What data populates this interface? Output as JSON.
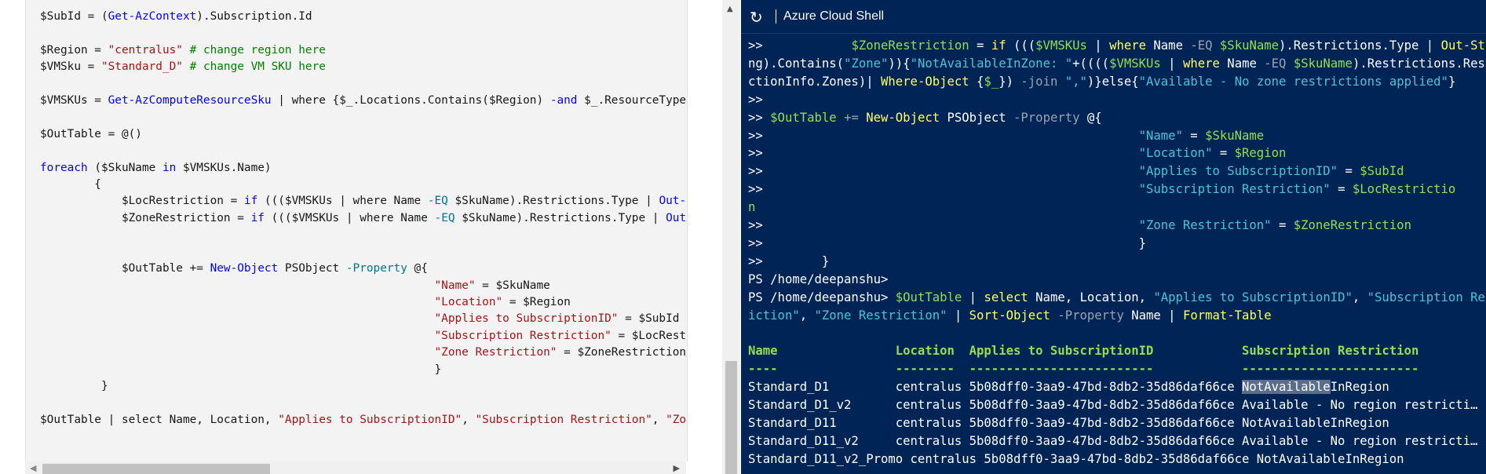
{
  "editor": {
    "lines": [
      [
        {
          "t": "$SubId = ("
        },
        {
          "t": "Get-AzContext",
          "c": "k"
        },
        {
          "t": ").Subscription.Id"
        }
      ],
      [],
      [
        {
          "t": "$Region = "
        },
        {
          "t": "\"centralus\"",
          "c": "s"
        },
        {
          "t": " # change region here",
          "c": "c"
        }
      ],
      [
        {
          "t": "$VMSku = "
        },
        {
          "t": "\"Standard_D\"",
          "c": "s"
        },
        {
          "t": " # change VM SKU here",
          "c": "c"
        }
      ],
      [],
      [
        {
          "t": "$VMSKUs = "
        },
        {
          "t": "Get-AzComputeResourceSku",
          "c": "k"
        },
        {
          "t": " | where {$_.Locations.Contains($Region) "
        },
        {
          "t": "-and",
          "c": "o"
        },
        {
          "t": " $_.ResourceType"
        }
      ],
      [],
      [
        {
          "t": "$OutTable = @()"
        }
      ],
      [],
      [
        {
          "t": "foreach",
          "c": "k"
        },
        {
          "t": " ($SkuName "
        },
        {
          "t": "in",
          "c": "k"
        },
        {
          "t": " $VMSKUs.Name)"
        }
      ],
      [
        {
          "t": "        {"
        }
      ],
      [
        {
          "t": "            $LocRestriction = "
        },
        {
          "t": "if",
          "c": "k"
        },
        {
          "t": " ((($VMSKUs | where Name "
        },
        {
          "t": "-EQ",
          "c": "p"
        },
        {
          "t": " $SkuName).Restrictions.Type | "
        },
        {
          "t": "Out-",
          "c": "k"
        }
      ],
      [
        {
          "t": "            $ZoneRestriction = "
        },
        {
          "t": "if",
          "c": "k"
        },
        {
          "t": " ((($VMSKUs | where Name "
        },
        {
          "t": "-EQ",
          "c": "p"
        },
        {
          "t": " $SkuName).Restrictions.Type | "
        },
        {
          "t": "Out",
          "c": "k"
        }
      ],
      [],
      [],
      [
        {
          "t": "            $OutTable += "
        },
        {
          "t": "New-Object",
          "c": "k"
        },
        {
          "t": " PSObject "
        },
        {
          "t": "-Property",
          "c": "p"
        },
        {
          "t": " @{"
        }
      ],
      [
        {
          "t": "                                                          "
        },
        {
          "t": "\"Name\"",
          "c": "s"
        },
        {
          "t": " = $SkuName"
        }
      ],
      [
        {
          "t": "                                                          "
        },
        {
          "t": "\"Location\"",
          "c": "s"
        },
        {
          "t": " = $Region"
        }
      ],
      [
        {
          "t": "                                                          "
        },
        {
          "t": "\"Applies to SubscriptionID\"",
          "c": "s"
        },
        {
          "t": " = $SubId"
        }
      ],
      [
        {
          "t": "                                                          "
        },
        {
          "t": "\"Subscription Restriction\"",
          "c": "s"
        },
        {
          "t": " = $LocRestr"
        }
      ],
      [
        {
          "t": "                                                          "
        },
        {
          "t": "\"Zone Restriction\"",
          "c": "s"
        },
        {
          "t": " = $ZoneRestriction"
        }
      ],
      [
        {
          "t": "                                                          }"
        }
      ],
      [
        {
          "t": "         }"
        }
      ],
      [],
      [
        {
          "t": "$OutTable | select Name, Location, "
        },
        {
          "t": "\"Applies to SubscriptionID\"",
          "c": "s"
        },
        {
          "t": ", "
        },
        {
          "t": "\"Subscription Restriction\"",
          "c": "s"
        },
        {
          "t": ", "
        },
        {
          "t": "\"Zo",
          "c": "s"
        }
      ]
    ]
  },
  "shell": {
    "title": "Azure Cloud Shell",
    "refresh_icon": "refresh-icon",
    "lines": [
      [
        {
          "t": ">>            "
        },
        {
          "t": "$ZoneRestriction",
          "c": "v"
        },
        {
          "t": " = "
        },
        {
          "t": "if",
          "c": "f"
        },
        {
          "t": " ((("
        },
        {
          "t": "$VMSKUs",
          "c": "v"
        },
        {
          "t": " | "
        },
        {
          "t": "where",
          "c": "f"
        },
        {
          "t": " Name "
        },
        {
          "t": "-EQ",
          "c": "o"
        },
        {
          "t": " "
        },
        {
          "t": "$SkuName",
          "c": "v"
        },
        {
          "t": ").Restrictions.Type | "
        },
        {
          "t": "Out-Stri",
          "c": "f"
        }
      ],
      [
        {
          "t": "ng).Contains("
        },
        {
          "t": "\"Zone\"",
          "c": "s"
        },
        {
          "t": ")){"
        },
        {
          "t": "\"NotAvailableInZone: \"",
          "c": "s"
        },
        {
          "t": "+(((("
        },
        {
          "t": "$VMSKUs",
          "c": "v"
        },
        {
          "t": " | "
        },
        {
          "t": "where",
          "c": "f"
        },
        {
          "t": " Name "
        },
        {
          "t": "-EQ",
          "c": "o"
        },
        {
          "t": " "
        },
        {
          "t": "$SkuName",
          "c": "v"
        },
        {
          "t": ").Restrictions.Restri"
        }
      ],
      [
        {
          "t": "ctionInfo.Zones)| "
        },
        {
          "t": "Where-Object",
          "c": "f"
        },
        {
          "t": " {"
        },
        {
          "t": "$_",
          "c": "v"
        },
        {
          "t": "}) "
        },
        {
          "t": "-join",
          "c": "o"
        },
        {
          "t": " "
        },
        {
          "t": "\",\"",
          "c": "s"
        },
        {
          "t": ")}else{"
        },
        {
          "t": "\"Available - No zone restrictions applied\"",
          "c": "s"
        },
        {
          "t": "}"
        }
      ],
      [
        {
          "t": ">>"
        }
      ],
      [
        {
          "t": ">> "
        },
        {
          "t": "$OutTable",
          "c": "v"
        },
        {
          "t": " "
        },
        {
          "t": "+=",
          "c": "o"
        },
        {
          "t": " "
        },
        {
          "t": "New-Object",
          "c": "f"
        },
        {
          "t": " PSObject "
        },
        {
          "t": "-Property",
          "c": "o"
        },
        {
          "t": " @{"
        }
      ],
      [
        {
          "t": ">>                                                   "
        },
        {
          "t": "\"Name\"",
          "c": "s"
        },
        {
          "t": " = "
        },
        {
          "t": "$SkuName",
          "c": "v"
        }
      ],
      [
        {
          "t": ">>                                                   "
        },
        {
          "t": "\"Location\"",
          "c": "s"
        },
        {
          "t": " = "
        },
        {
          "t": "$Region",
          "c": "v"
        }
      ],
      [
        {
          "t": ">>                                                   "
        },
        {
          "t": "\"Applies to SubscriptionID\"",
          "c": "s"
        },
        {
          "t": " = "
        },
        {
          "t": "$SubId",
          "c": "v"
        }
      ],
      [
        {
          "t": ">>                                                   "
        },
        {
          "t": "\"Subscription Restriction\"",
          "c": "s"
        },
        {
          "t": " = "
        },
        {
          "t": "$LocRestrictio",
          "c": "v"
        }
      ],
      [
        {
          "t": "n",
          "c": "v"
        }
      ],
      [
        {
          "t": ">>                                                   "
        },
        {
          "t": "\"Zone Restriction\"",
          "c": "s"
        },
        {
          "t": " = "
        },
        {
          "t": "$ZoneRestriction",
          "c": "v"
        }
      ],
      [
        {
          "t": ">>                                                   }"
        }
      ],
      [
        {
          "t": ">>        }"
        }
      ],
      [
        {
          "t": "PS /home/deepanshu>"
        }
      ],
      [
        {
          "t": "PS /home/deepanshu> "
        },
        {
          "t": "$OutTable",
          "c": "v"
        },
        {
          "t": " | "
        },
        {
          "t": "select",
          "c": "f"
        },
        {
          "t": " Name, Location, "
        },
        {
          "t": "\"Applies to SubscriptionID\"",
          "c": "s"
        },
        {
          "t": ", "
        },
        {
          "t": "\"Subscription Restr",
          "c": "s"
        }
      ],
      [
        {
          "t": "iction\"",
          "c": "s"
        },
        {
          "t": ", "
        },
        {
          "t": "\"Zone Restriction\"",
          "c": "s"
        },
        {
          "t": " | "
        },
        {
          "t": "Sort-Object",
          "c": "f"
        },
        {
          "t": " "
        },
        {
          "t": "-Property",
          "c": "o"
        },
        {
          "t": " Name | "
        },
        {
          "t": "Format-Table",
          "c": "f"
        }
      ],
      [],
      [
        {
          "t": "Name                Location  Applies to SubscriptionID            Subscription Restriction",
          "c": "h"
        }
      ],
      [
        {
          "t": "----                --------  -------------------------            ------------------------",
          "c": "h"
        }
      ],
      [
        {
          "t": "Standard_D1         centralus 5b08dff0-3aa9-47bd-8db2-35d86daf66ce "
        },
        {
          "t": "NotAvailable",
          "c": "hl"
        },
        {
          "t": "InRegion"
        }
      ],
      [
        {
          "t": "Standard_D1_v2      centralus 5b08dff0-3aa9-47bd-8db2-35d86daf66ce Available - No region restricti…"
        }
      ],
      [
        {
          "t": "Standard_D11        centralus 5b08dff0-3aa9-47bd-8db2-35d86daf66ce NotAvailableInRegion"
        }
      ],
      [
        {
          "t": "Standard_D11_v2     centralus 5b08dff0-3aa9-47bd-8db2-35d86daf66ce Available - No region restricti…"
        }
      ],
      [
        {
          "t": "Standard_D11_v2_Promo centralus 5b08dff0-3aa9-47bd-8db2-35d86daf66ce NotAvailableInRegion"
        }
      ]
    ]
  },
  "colors": {
    "editor_bg": "#f3f3f3",
    "shell_bg": "#012456",
    "keyword": "#0101fd",
    "string": "#a31515",
    "comment": "#008000",
    "shell_variable": "#92e051",
    "shell_cmdlet": "#ffff60",
    "shell_string": "#4bc4d8"
  }
}
